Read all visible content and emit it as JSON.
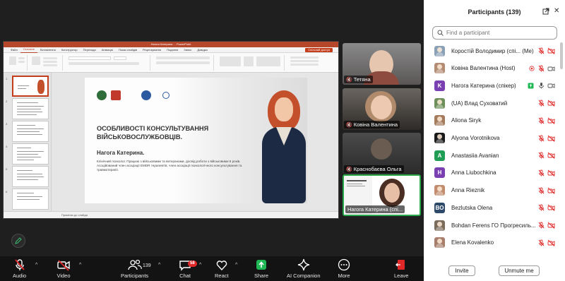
{
  "powerpoint": {
    "window_title": "Нагога Катерина ... PowerPoint",
    "tabs": [
      "Файл",
      "Основне",
      "Вставлення",
      "Конструктор",
      "Переходи",
      "Анімація",
      "Показ слайдів",
      "Рецензування",
      "Подання",
      "Запис",
      "Довідка"
    ],
    "active_tab": "Основне",
    "share_button": "Спільний доступ",
    "notes_label": "Примітки до слайда",
    "slide": {
      "heading": "ОСОБЛИВОСТІ КОНСУЛЬТУВАННЯ ВІЙСЬКОВОСЛУЖБОВЦІВ.",
      "presenter": "Нагога Катерина.",
      "description": "Клінічний психолог. Працюю з військовими та ветеранами, досвід роботи з військовими 5 років. Асоційований член асоціації EMDR терапевтів, член асоціації психологічного консультування та травмотерапії."
    },
    "thumbnail_numbers": [
      "1",
      "2",
      "3",
      "4",
      "5",
      "6"
    ]
  },
  "videos": [
    {
      "name": "Тетяна"
    },
    {
      "name": "Ковіна Валентина"
    },
    {
      "name": "Краснобаєва Ольга"
    },
    {
      "name": "Нагога Катерина (спі..."
    }
  ],
  "toolbar": {
    "audio": "Audio",
    "video": "Video",
    "participants": "Participants",
    "participants_count": "139",
    "chat": "Chat",
    "chat_badge": "58",
    "react": "React",
    "share": "Share",
    "ai_companion": "AI Companion",
    "more": "More",
    "leave": "Leave"
  },
  "panel": {
    "title": "Participants (139)",
    "search_placeholder": "Find a participant",
    "invite": "Invite",
    "unmute_me": "Unmute me",
    "participants": [
      {
        "name": "Коростій Володимир (спі... (Me)",
        "avatar_letter": "",
        "avatar_color": "#8aa0b6",
        "mic": "muted",
        "cam": "off"
      },
      {
        "name": "Ковіна Валентина (Host)",
        "avatar_letter": "",
        "avatar_color": "#b48c73",
        "mic": "muted",
        "cam": "on",
        "extra": "record"
      },
      {
        "name": "Нагога Катерина (спікер)",
        "avatar_letter": "K",
        "avatar_color": "#7a3fb0",
        "mic": "on",
        "cam": "on",
        "extra": "share"
      },
      {
        "name": "(UA) Влад Суховатий",
        "avatar_letter": "",
        "avatar_color": "#6d8f5a",
        "mic": "muted",
        "cam": "off"
      },
      {
        "name": "Aliona Siryk",
        "avatar_letter": "",
        "avatar_color": "#a57b5e",
        "mic": "muted",
        "cam": "off"
      },
      {
        "name": "Alyona Vorotnikova",
        "avatar_letter": "",
        "avatar_color": "#1a1a1a",
        "mic": "muted",
        "cam": "off"
      },
      {
        "name": "Anastasiia Avanian",
        "avatar_letter": "A",
        "avatar_color": "#1f9d55",
        "mic": "muted",
        "cam": "off"
      },
      {
        "name": "Anna Liubochkina",
        "avatar_letter": "H",
        "avatar_color": "#7a3fb0",
        "mic": "muted",
        "cam": "off"
      },
      {
        "name": "Anna Rieznik",
        "avatar_letter": "",
        "avatar_color": "#c28d6e",
        "mic": "muted",
        "cam": "off"
      },
      {
        "name": "Bezlutska Olena",
        "avatar_letter": "BO",
        "avatar_color": "#2d4a6b",
        "mic": "muted",
        "cam": "off"
      },
      {
        "name": "Bohdan Ferens ГО Прогресиль...",
        "avatar_letter": "",
        "avatar_color": "#7b6b5a",
        "mic": "muted",
        "cam": "off"
      },
      {
        "name": "Elena Kovalenko",
        "avatar_letter": "",
        "avatar_color": "#a77d6b",
        "mic": "muted",
        "cam": "off"
      }
    ]
  },
  "colors": {
    "muted_red": "#e02828",
    "active_green": "#2aa84a",
    "ppt_accent": "#b7472a"
  }
}
